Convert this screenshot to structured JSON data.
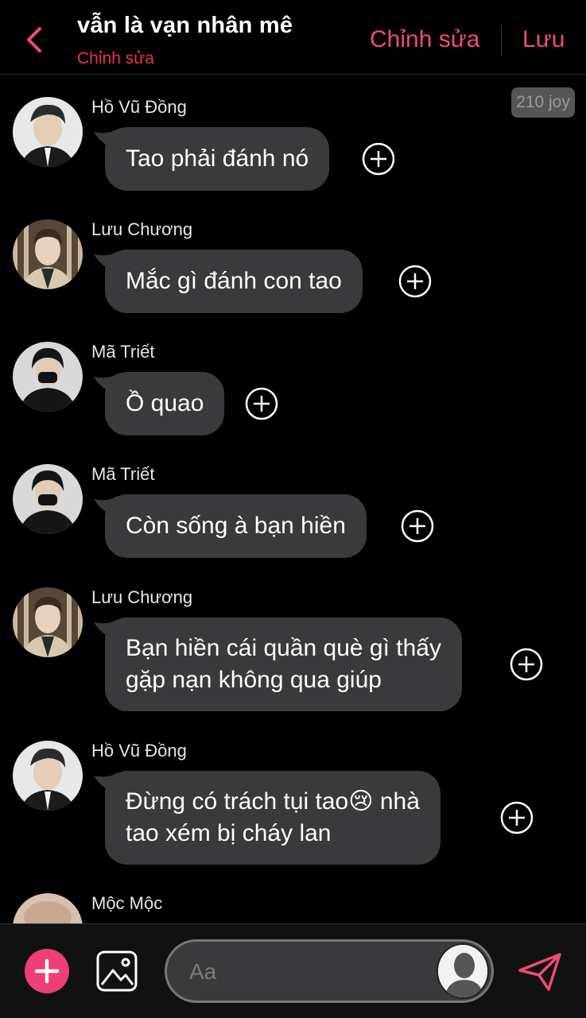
{
  "header": {
    "title": "vẫn là vạn nhân mê",
    "subtitle": "Chỉnh sửa",
    "edit_label": "Chỉnh sửa",
    "save_label": "Lưu"
  },
  "joy_badge": "210 joy",
  "messages": [
    {
      "sender": "Hồ Vũ Đồng",
      "lines": [
        "Tao phải đánh nó"
      ]
    },
    {
      "sender": "Lưu Chương",
      "lines": [
        "Mắc gì đánh con tao"
      ]
    },
    {
      "sender": "Mã Triết",
      "lines": [
        "Ồ quao"
      ]
    },
    {
      "sender": "Mã Triết",
      "lines": [
        "Còn sống à bạn hiền"
      ]
    },
    {
      "sender": "Lưu Chương",
      "lines": [
        "Bạn hiền cái quần què gì thấy",
        "gặp nạn không qua giúp"
      ]
    },
    {
      "sender": "Hồ Vũ Đồng",
      "lines": [
        "Đừng có trách tụi tao",
        "tao xém bị cháy lan"
      ],
      "emoji": "😢",
      "line1_suffix": " nhà"
    },
    {
      "sender": "Mộc Mộc",
      "lines": []
    }
  ],
  "composer": {
    "placeholder": "Aa"
  },
  "colors": {
    "accent": "#f04b73",
    "subtitle": "#e8344a",
    "bubble": "#3a3a3c",
    "add_button": "#ef3f76"
  },
  "icons": {
    "back": "chevron-left-icon",
    "plus": "plus-circle-icon",
    "add": "add-icon",
    "image": "image-icon",
    "send": "send-icon"
  }
}
